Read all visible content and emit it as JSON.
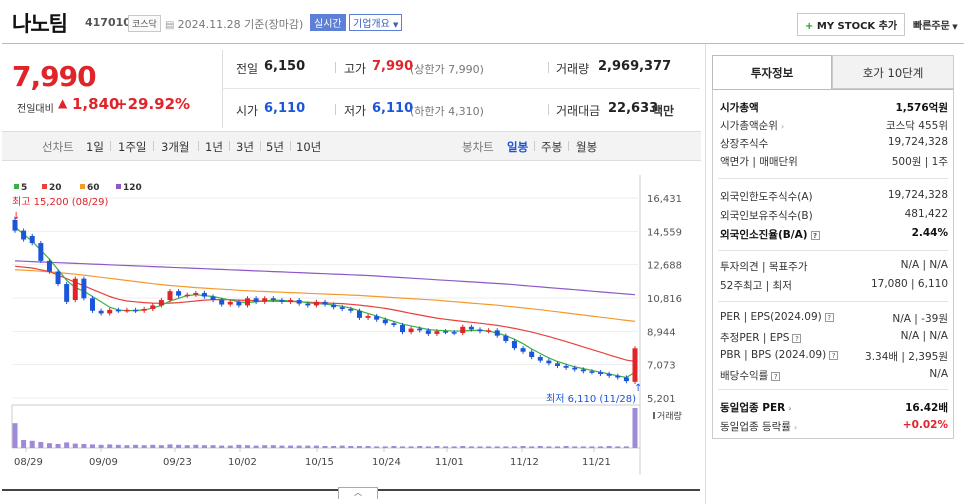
{
  "header": {
    "name": "나노팀",
    "code": "417010",
    "market": "코스닥",
    "date": "2024.11.28 기준(장마감)",
    "realtime": "실시간",
    "company_info": "기업개요",
    "mystock_btn": "MY STOCK 추가",
    "quick_order": "빠른주문"
  },
  "price": {
    "current": "7,990",
    "change_label": "전일대비",
    "change_abs": "1,840",
    "change_pct": "+29.92%"
  },
  "stats": {
    "prev_label": "전일",
    "prev": "6,150",
    "high_label": "고가",
    "high": "7,990",
    "high_sub": "(상한가 7,990)",
    "volume_label": "거래량",
    "volume": "2,969,377",
    "open_label": "시가",
    "open": "6,110",
    "low_label": "저가",
    "low": "6,110",
    "low_sub": "(하한가 4,310)",
    "amount_label": "거래대금",
    "amount": "22,633",
    "amount_unit": "백만"
  },
  "period_bar": {
    "line_label": "선차트",
    "periods": [
      "1일",
      "1주일",
      "3개월",
      "1년",
      "3년",
      "5년",
      "10년"
    ],
    "candle_label": "봉차트",
    "candles": [
      "일봉",
      "주봉",
      "월봉"
    ]
  },
  "chart_data": {
    "type": "candlestick",
    "legend": [
      "5",
      "20",
      "60",
      "120"
    ],
    "legend_colors": [
      "#3cb043",
      "#e8413c",
      "#f39a2e",
      "#8e58c7"
    ],
    "y_ticks": [
      "16,431",
      "14,559",
      "12,688",
      "10,816",
      "8,944",
      "7,073",
      "5,201"
    ],
    "ylim": [
      5201,
      16431
    ],
    "x_ticks": [
      "08/29",
      "09/09",
      "09/23",
      "10/02",
      "10/15",
      "10/24",
      "11/01",
      "11/12",
      "11/21"
    ],
    "max_label": "최고 15,200 (08/29)",
    "min_label": "최저 6,110 (11/28)",
    "volume_label": "거래량",
    "up_color": "#e0242a",
    "down_color": "#1c56d8",
    "candles": [
      {
        "o": 15200,
        "c": 14600
      },
      {
        "o": 14600,
        "c": 14100
      },
      {
        "o": 14300,
        "c": 13900
      },
      {
        "o": 13900,
        "c": 12900
      },
      {
        "o": 12900,
        "c": 12300
      },
      {
        "o": 12300,
        "c": 11600
      },
      {
        "o": 11600,
        "c": 10600
      },
      {
        "o": 10700,
        "c": 11900
      },
      {
        "o": 11900,
        "c": 10800
      },
      {
        "o": 10800,
        "c": 10100
      },
      {
        "o": 10100,
        "c": 9950
      },
      {
        "o": 9950,
        "c": 10150
      },
      {
        "o": 10150,
        "c": 10100
      },
      {
        "o": 10100,
        "c": 10150
      },
      {
        "o": 10150,
        "c": 10100
      },
      {
        "o": 10100,
        "c": 10200
      },
      {
        "o": 10200,
        "c": 10400
      },
      {
        "o": 10400,
        "c": 10700
      },
      {
        "o": 10700,
        "c": 11200
      },
      {
        "o": 11200,
        "c": 10950
      },
      {
        "o": 10950,
        "c": 11000
      },
      {
        "o": 11000,
        "c": 11100
      },
      {
        "o": 11100,
        "c": 10900
      },
      {
        "o": 10900,
        "c": 10700
      },
      {
        "o": 10700,
        "c": 10450
      },
      {
        "o": 10450,
        "c": 10600
      },
      {
        "o": 10600,
        "c": 10400
      },
      {
        "o": 10400,
        "c": 10800
      },
      {
        "o": 10800,
        "c": 10600
      },
      {
        "o": 10600,
        "c": 10800
      },
      {
        "o": 10800,
        "c": 10700
      },
      {
        "o": 10700,
        "c": 10600
      },
      {
        "o": 10600,
        "c": 10700
      },
      {
        "o": 10700,
        "c": 10500
      },
      {
        "o": 10500,
        "c": 10400
      },
      {
        "o": 10400,
        "c": 10600
      },
      {
        "o": 10600,
        "c": 10450
      },
      {
        "o": 10450,
        "c": 10300
      },
      {
        "o": 10300,
        "c": 10200
      },
      {
        "o": 10200,
        "c": 10100
      },
      {
        "o": 10100,
        "c": 9700
      },
      {
        "o": 9700,
        "c": 9800
      },
      {
        "o": 9800,
        "c": 9600
      },
      {
        "o": 9600,
        "c": 9400
      },
      {
        "o": 9400,
        "c": 9300
      },
      {
        "o": 9300,
        "c": 8900
      },
      {
        "o": 8900,
        "c": 9100
      },
      {
        "o": 9100,
        "c": 9000
      },
      {
        "o": 9000,
        "c": 8800
      },
      {
        "o": 8800,
        "c": 8950
      },
      {
        "o": 8950,
        "c": 8900
      },
      {
        "o": 8900,
        "c": 8850
      },
      {
        "o": 8850,
        "c": 9200
      },
      {
        "o": 9200,
        "c": 9050
      },
      {
        "o": 9050,
        "c": 8950
      },
      {
        "o": 8950,
        "c": 9000
      },
      {
        "o": 9000,
        "c": 8700
      },
      {
        "o": 8700,
        "c": 8400
      },
      {
        "o": 8400,
        "c": 8000
      },
      {
        "o": 8000,
        "c": 7800
      },
      {
        "o": 7800,
        "c": 7500
      },
      {
        "o": 7500,
        "c": 7300
      },
      {
        "o": 7300,
        "c": 7150
      },
      {
        "o": 7150,
        "c": 7000
      },
      {
        "o": 7000,
        "c": 6900
      },
      {
        "o": 6900,
        "c": 6800
      },
      {
        "o": 6800,
        "c": 6700
      },
      {
        "o": 6700,
        "c": 6650
      },
      {
        "o": 6650,
        "c": 6550
      },
      {
        "o": 6550,
        "c": 6450
      },
      {
        "o": 6450,
        "c": 6350
      },
      {
        "o": 6350,
        "c": 6150
      },
      {
        "o": 6110,
        "c": 7990
      }
    ],
    "ma5": [
      14800,
      14400,
      14000,
      13500,
      13000,
      12400,
      11800,
      11400,
      11200,
      10900,
      10600,
      10300,
      10150,
      10100,
      10120,
      10150,
      10250,
      10400,
      10650,
      10800,
      10950,
      11000,
      10950,
      10900,
      10800,
      10700,
      10600,
      10550,
      10600,
      10650,
      10700,
      10680,
      10650,
      10620,
      10550,
      10500,
      10480,
      10420,
      10350,
      10250,
      10100,
      9950,
      9800,
      9650,
      9500,
      9350,
      9250,
      9150,
      9050,
      9000,
      8980,
      8950,
      8970,
      8990,
      9010,
      8960,
      8850,
      8700,
      8500,
      8250,
      7950,
      7700,
      7450,
      7250,
      7100,
      6950,
      6850,
      6750,
      6650,
      6550,
      6450,
      6350,
      6650
    ],
    "ma20": [
      12600,
      12550,
      12500,
      12400,
      12300,
      12100,
      11900,
      11700,
      11500,
      11300,
      11100,
      10900,
      10750,
      10650,
      10600,
      10560,
      10530,
      10520,
      10530,
      10560,
      10600,
      10650,
      10700,
      10720,
      10730,
      10720,
      10700,
      10680,
      10660,
      10650,
      10640,
      10630,
      10620,
      10600,
      10580,
      10560,
      10540,
      10520,
      10500,
      10460,
      10420,
      10360,
      10300,
      10230,
      10150,
      10050,
      9950,
      9860,
      9770,
      9690,
      9620,
      9560,
      9500,
      9450,
      9400,
      9340,
      9280,
      9200,
      9110,
      9010,
      8900,
      8780,
      8650,
      8510,
      8370,
      8220,
      8070,
      7920,
      7770,
      7620,
      7470,
      7330,
      7250
    ],
    "ma60": [
      12400,
      12380,
      12350,
      12320,
      12280,
      12240,
      12200,
      12150,
      12100,
      12040,
      11980,
      11920,
      11860,
      11800,
      11740,
      11680,
      11620,
      11570,
      11520,
      11480,
      11440,
      11400,
      11370,
      11340,
      11310,
      11280,
      11250,
      11220,
      11200,
      11180,
      11160,
      11140,
      11120,
      11100,
      11080,
      11060,
      11040,
      11020,
      11000,
      10980,
      10960,
      10930,
      10900,
      10870,
      10840,
      10810,
      10780,
      10750,
      10720,
      10690,
      10650,
      10610,
      10570,
      10530,
      10490,
      10450,
      10410,
      10360,
      10310,
      10260,
      10210,
      10160,
      10100,
      10040,
      9980,
      9920,
      9860,
      9800,
      9740,
      9680,
      9620,
      9560,
      9500
    ],
    "ma120": [
      12900,
      12880,
      12860,
      12840,
      12820,
      12800,
      12780,
      12760,
      12740,
      12720,
      12700,
      12680,
      12660,
      12640,
      12620,
      12600,
      12580,
      12560,
      12540,
      12520,
      12500,
      12480,
      12460,
      12440,
      12420,
      12400,
      12380,
      12360,
      12340,
      12320,
      12300,
      12280,
      12260,
      12240,
      12220,
      12200,
      12180,
      12160,
      12140,
      12120,
      12100,
      12080,
      12050,
      12020,
      11990,
      11960,
      11930,
      11900,
      11870,
      11840,
      11810,
      11780,
      11750,
      11720,
      11690,
      11660,
      11630,
      11600,
      11560,
      11520,
      11480,
      11440,
      11400,
      11360,
      11320,
      11280,
      11240,
      11200,
      11160,
      11120,
      11080,
      11040,
      11000
    ],
    "volume": [
      62,
      20,
      18,
      15,
      12,
      10,
      14,
      11,
      10,
      9,
      8,
      9,
      8,
      7,
      8,
      7,
      8,
      7,
      9,
      8,
      7,
      8,
      7,
      7,
      6,
      6,
      8,
      7,
      6,
      7,
      7,
      6,
      6,
      6,
      6,
      6,
      5,
      5,
      6,
      5,
      5,
      5,
      4,
      4,
      5,
      4,
      4,
      5,
      4,
      5,
      4,
      4,
      5,
      4,
      4,
      4,
      4,
      4,
      4,
      5,
      4,
      5,
      4,
      4,
      5,
      4,
      4,
      4,
      4,
      5,
      4,
      4,
      100
    ]
  },
  "side_panel": {
    "tab_info": "투자정보",
    "tab_ask": "호가 10단계",
    "rows1": [
      {
        "label": "시가총액",
        "value": "1,576억원",
        "bold": true
      },
      {
        "label": "시가총액순위",
        "value": "코스닥 455위",
        "arrow": true
      },
      {
        "label": "상장주식수",
        "value": "19,724,328"
      },
      {
        "label": "액면가 | 매매단위",
        "value": "500원 | 1주"
      }
    ],
    "rows2": [
      {
        "label": "외국인한도주식수(A)",
        "value": "19,724,328"
      },
      {
        "label": "외국인보유주식수(B)",
        "value": "481,422"
      },
      {
        "label": "외국인소진율(B/A)",
        "value": "2.44%",
        "bold": true,
        "q": true
      }
    ],
    "rows3": [
      {
        "label": "투자의견 | 목표주가",
        "value": "N/A | N/A"
      },
      {
        "label": "52주최고 | 최저",
        "value": "17,080 | 6,110"
      }
    ],
    "rows4": [
      {
        "label": "PER | EPS(2024.09)",
        "value": "N/A | -39원",
        "q": true
      },
      {
        "label": "추정PER | EPS",
        "value": "N/A | N/A",
        "q": true
      },
      {
        "label": "PBR | BPS (2024.09)",
        "value": "3.34배 | 2,395원",
        "q": true
      },
      {
        "label": "배당수익률",
        "value": "N/A",
        "q": true
      }
    ],
    "rows5": [
      {
        "label": "동일업종 PER",
        "value": "16.42배",
        "bold": true,
        "arrow": true
      },
      {
        "label": "동일업종 등락률",
        "value": "+0.02%",
        "red": true,
        "arrow": true
      }
    ]
  },
  "toggle_icon": "chevron-up-icon"
}
